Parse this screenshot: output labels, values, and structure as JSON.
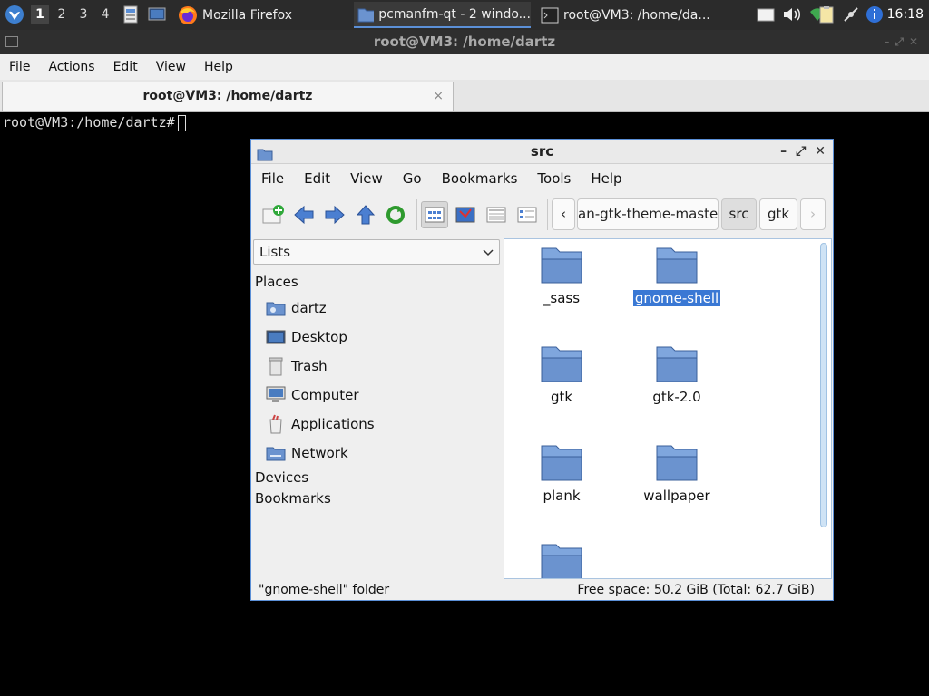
{
  "taskbar": {
    "desktops": [
      "1",
      "2",
      "3",
      "4"
    ],
    "active_desktop": "1",
    "tasks": [
      {
        "label": "Mozilla Firefox",
        "icon": "firefox-icon"
      },
      {
        "label": "pcmanfm-qt - 2 windo...",
        "icon": "folder-icon",
        "active": true
      },
      {
        "label": "root@VM3: /home/da...",
        "icon": "terminal-icon"
      }
    ],
    "clock": "16:18"
  },
  "terminal": {
    "title": "root@VM3: /home/dartz",
    "menu": [
      "File",
      "Actions",
      "Edit",
      "View",
      "Help"
    ],
    "tab_label": "root@VM3: /home/dartz",
    "tab_close": "×",
    "prompt": "root@VM3:/home/dartz#"
  },
  "filemanager": {
    "title": "src",
    "window_buttons": [
      "–",
      "⤢",
      "✕"
    ],
    "menu": [
      "File",
      "Edit",
      "View",
      "Go",
      "Bookmarks",
      "Tools",
      "Help"
    ],
    "breadcrumbs": [
      "an-gtk-theme-master",
      "src",
      "gtk"
    ],
    "current_crumb": "src",
    "side_mode": "Lists",
    "sidebar": {
      "places_label": "Places",
      "places": [
        {
          "label": "dartz",
          "icon": "home-folder-icon"
        },
        {
          "label": "Desktop",
          "icon": "desktop-icon"
        },
        {
          "label": "Trash",
          "icon": "trash-icon"
        },
        {
          "label": "Computer",
          "icon": "computer-icon"
        },
        {
          "label": "Applications",
          "icon": "applications-icon"
        },
        {
          "label": "Network",
          "icon": "network-folder-icon"
        }
      ],
      "devices_label": "Devices",
      "bookmarks_label": "Bookmarks"
    },
    "files": [
      {
        "name": "_sass",
        "selected": false
      },
      {
        "name": "gnome-shell",
        "selected": true
      },
      {
        "name": "gtk",
        "selected": false
      },
      {
        "name": "gtk-2.0",
        "selected": false
      },
      {
        "name": "plank",
        "selected": false
      },
      {
        "name": "wallpaper",
        "selected": false
      },
      {
        "name": "",
        "selected": false
      }
    ],
    "status_left": "\"gnome-shell\" folder",
    "status_right": "Free space: 50.2 GiB (Total: 62.7 GiB)"
  },
  "colors": {
    "selection": "#3a78d4",
    "folder": "#6b93cf",
    "accent": "#5b8fd6"
  }
}
